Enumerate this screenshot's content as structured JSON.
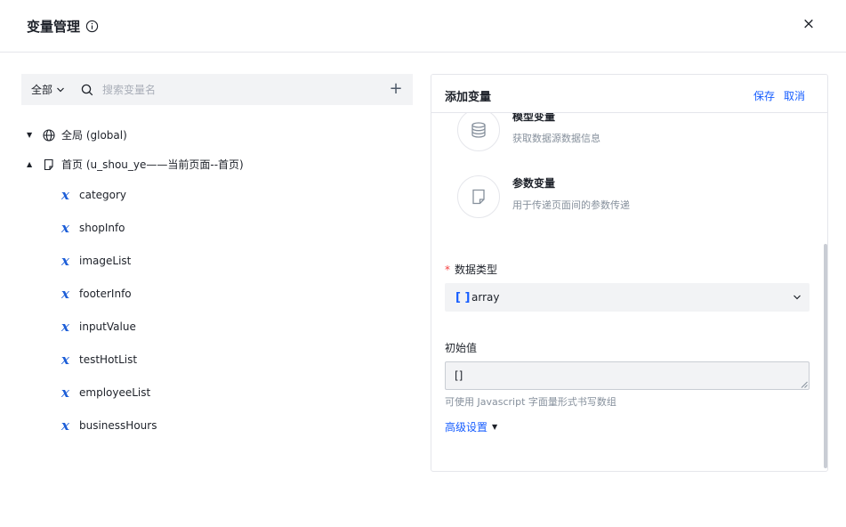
{
  "dialog": {
    "title": "变量管理",
    "close": "×"
  },
  "left": {
    "scope": "全部",
    "search_placeholder": "搜索变量名",
    "add": "+",
    "global_node": "全局 (global)",
    "page_node": "首页 (u_shou_ye——当前页面--首页)",
    "variables": [
      "category",
      "shopInfo",
      "imageList",
      "footerInfo",
      "inputValue",
      "testHotList",
      "employeeList",
      "businessHours"
    ]
  },
  "right": {
    "title": "添加变量",
    "save": "保存",
    "cancel": "取消",
    "options": [
      {
        "name": "模型变量",
        "desc": "获取数据源数据信息",
        "icon": "database-icon"
      },
      {
        "name": "参数变量",
        "desc": "用于传递页面间的参数传递",
        "icon": "document-icon"
      }
    ],
    "data_type_label": "数据类型",
    "data_type_value": "array",
    "data_type_icon": "[ ]",
    "initial_label": "初始值",
    "initial_value": "[]",
    "hint": "可使用 Javascript 字面量形式书写数组",
    "advanced": "高级设置"
  },
  "colors": {
    "accent": "#165dff",
    "required": "#f53f3f",
    "variable_icon": "#1e5fd8"
  }
}
